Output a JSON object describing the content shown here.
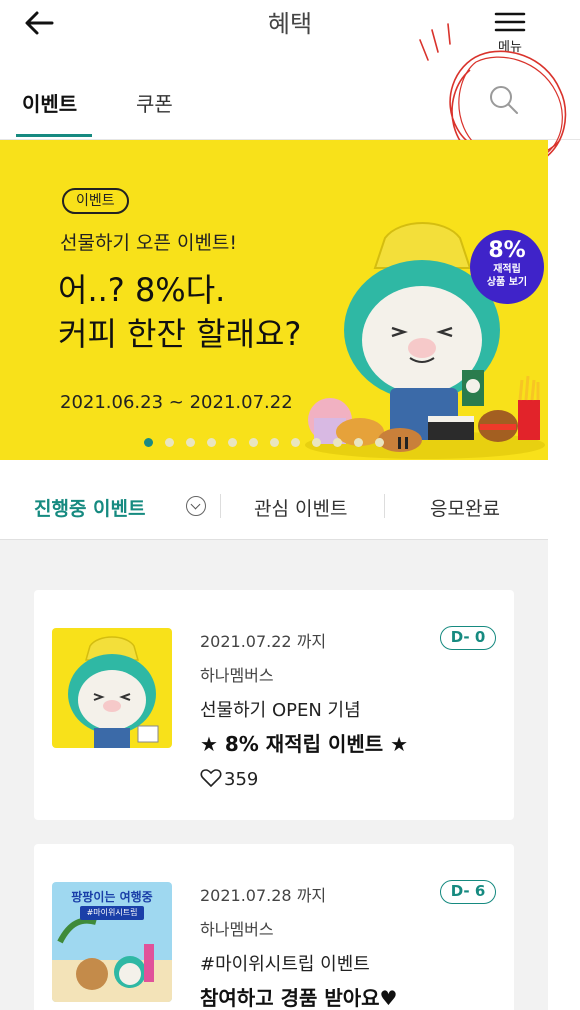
{
  "header": {
    "title": "혜택",
    "menu_label": "메뉴"
  },
  "tabs": [
    {
      "label": "이벤트",
      "active": true
    },
    {
      "label": "쿠폰",
      "active": false
    }
  ],
  "banner": {
    "pill": "이벤트",
    "subtitle": "선물하기 오픈 이벤트!",
    "headline": "어..? 8%다.\n커피 한잔 할래요?",
    "date_range": "2021.06.23 ~ 2021.07.22",
    "badge": {
      "percent": "8%",
      "line1": "재적립",
      "line2": "상품 보기"
    },
    "pager": {
      "total": 13,
      "current": 1
    },
    "bg_color": "#f8e11a",
    "accent_color": "#168a80"
  },
  "filters": {
    "active": "진행중 이벤트",
    "mid": "관심 이벤트",
    "right": "응모완료"
  },
  "events": [
    {
      "date": "2021.07.22 까지",
      "dday": "D- 0",
      "org": "하나멤버스",
      "line1": "선물하기 OPEN 기념",
      "line2": "★ 8% 재적립 이벤트 ★",
      "likes": "359"
    },
    {
      "date": "2021.07.28 까지",
      "dday": "D- 6",
      "org": "하나멤버스",
      "line1": "#마이위시트립 이벤트",
      "line2": "참여하고 경품 받아요♥",
      "thumb_title": "팡팡이는 여행중",
      "thumb_tag": "#마이위시트립"
    }
  ],
  "icons": {
    "back": "arrow-left-icon",
    "menu": "hamburger-icon",
    "search": "search-icon",
    "heart": "heart-outline-icon",
    "pause": "pause-icon"
  }
}
